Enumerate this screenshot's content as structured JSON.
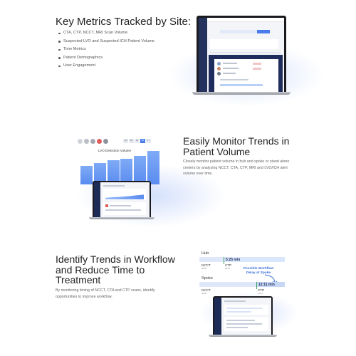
{
  "section1": {
    "title": "Key Metrics Tracked by Site:",
    "bullets": [
      "CTA, CTP, NCCT, MRI Scan Volume",
      "Suspected LVO and Suspected ICH Patient Volume",
      "Time Metrics",
      "Patient Demographics",
      "User Engagement"
    ]
  },
  "section2": {
    "title": "Easily Monitor Trends in Patient Volume",
    "body": "Closely monitor patient volume in hub and spoke or stand alone centers by analyzing NCCT, CTA, CTP, MRI and LVO/ICH alert volume over time.",
    "chart_card": {
      "chart_title": "LVO Detection Volume",
      "tabs": [
        "1W",
        "1M",
        "3M",
        "6M",
        "1Y"
      ],
      "active_tab": "6M",
      "legend_colors": [
        "#cfd3da",
        "#b9bec7",
        "#a3a9b3",
        "#e05b5b",
        "#8e949e"
      ]
    }
  },
  "chart_data": {
    "type": "bar",
    "title": "LVO Detection Volume",
    "categories": [
      "",
      "",
      "",
      "",
      "",
      ""
    ],
    "values": [
      40,
      46,
      52,
      56,
      62,
      72
    ],
    "ylim": [
      0,
      80
    ],
    "xlabel": "",
    "ylabel": ""
  },
  "section3": {
    "title": "Identify Trends in Workflow and Reduce Time to Treatment",
    "body": "By monitoring timing of NCCT, CTA and CTP scans, identify opportunities to improve workflow.",
    "timeline": {
      "hub_label": "Hub",
      "hub_time": "5:25 min",
      "hub_events": [
        {
          "name": "NCCT",
          "time": "00:00"
        },
        {
          "name": "CTP",
          "time": "05:25"
        }
      ],
      "delay_text": "Possible Workflow Delay at Spoke",
      "spoke_label": "Spoke",
      "spoke_time": "12:11 min",
      "spoke_events": [
        {
          "name": "NCCT",
          "time": "00:00"
        },
        {
          "name": "CTP",
          "time": "12:11"
        }
      ]
    }
  },
  "colors": {
    "accent": "#4a7bea",
    "sidebar": "#1d2b57",
    "bar": "#5a8cf0"
  }
}
